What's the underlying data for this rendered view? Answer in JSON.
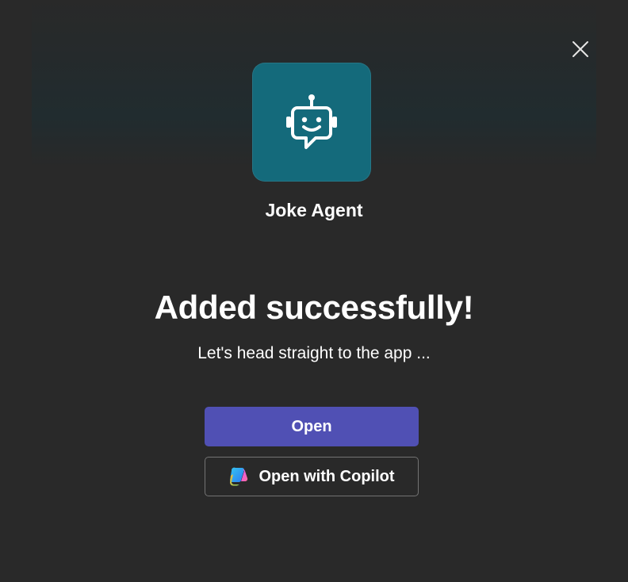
{
  "dialog": {
    "app_name": "Joke Agent",
    "headline": "Added successfully!",
    "subtext": "Let's head straight to the app ...",
    "primary_button": "Open",
    "secondary_button": "Open with Copilot",
    "close_icon": "close-icon",
    "app_icon": "robot-chat-icon",
    "copilot_icon": "copilot-icon"
  },
  "colors": {
    "background": "#292929",
    "app_tile": "#146a7b",
    "primary_button": "#5050b4",
    "secondary_border": "#737373",
    "text": "#ffffff"
  }
}
